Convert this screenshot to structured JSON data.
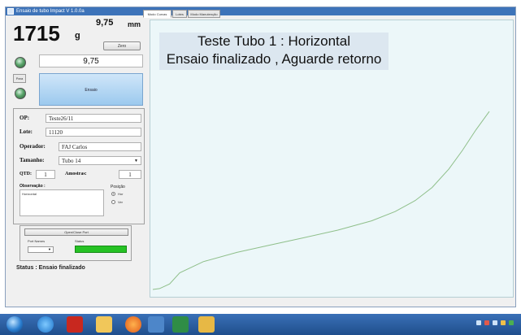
{
  "window": {
    "title": "Ensaio de tubo Impact V 1.0.0a"
  },
  "left_panel": {
    "weight_value": "1715",
    "weight_unit": "g",
    "position_value": "9,75",
    "position_unit": "mm",
    "zero_label": "Zero",
    "position_field": "9,75",
    "para_label": "Para",
    "ensaio_label": "Ensaio",
    "form": {
      "op_label": "OP:",
      "op_value": "Teste26/11",
      "lote_label": "Lote:",
      "lote_value": "11120",
      "operador_label": "Operador:",
      "operador_value": "FAJ Carlos",
      "tamanho_label": "Tamanho:",
      "tamanho_value": "Tubo 14",
      "qtd_label": "QTD:",
      "qtd_value": "1",
      "amostras_label": "Amostras:",
      "amostras_value": "1",
      "observacao_label": "Observação :",
      "observacao_value": "Horizontal",
      "posicao_label": "Posição",
      "radio_hor": "Hor",
      "radio_ver": "Ver"
    },
    "port": {
      "open_close_label": "Open/Close Port",
      "port_names_label": "Port Names",
      "status_label": "Status"
    },
    "status_text": "Status : Ensaio finalizado"
  },
  "tabs": [
    "Modo Curvas",
    "Lotes",
    "Modo Manutenção"
  ],
  "message": {
    "line1": "Teste Tubo 1 : Horizontal",
    "line2": "Ensaio finalizado , Aguarde retorno"
  },
  "curve": {
    "color": "#8fbf8a",
    "points": [
      [
        0,
        0
      ],
      [
        0.02,
        0.005
      ],
      [
        0.05,
        0.03
      ],
      [
        0.08,
        0.09
      ],
      [
        0.15,
        0.15
      ],
      [
        0.25,
        0.2
      ],
      [
        0.35,
        0.24
      ],
      [
        0.45,
        0.28
      ],
      [
        0.55,
        0.32
      ],
      [
        0.65,
        0.37
      ],
      [
        0.72,
        0.42
      ],
      [
        0.78,
        0.48
      ],
      [
        0.83,
        0.55
      ],
      [
        0.88,
        0.65
      ],
      [
        0.92,
        0.75
      ],
      [
        0.96,
        0.86
      ],
      [
        1.0,
        0.96
      ]
    ]
  },
  "taskbar": {
    "icons": [
      "start-orb-icon",
      "ie-icon",
      "acrobat-icon",
      "folder-icon",
      "media-player-icon",
      "calculator-icon",
      "excel-icon",
      "paint-icon"
    ]
  }
}
